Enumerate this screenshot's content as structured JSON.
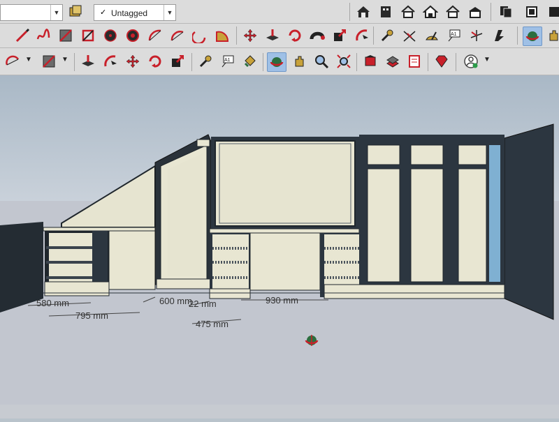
{
  "toolbar": {
    "layer": {
      "selected": "Untagged",
      "check": "✓"
    },
    "rows": [
      {
        "row": "standard",
        "tools": [
          "style-icon",
          "house-icon",
          "component-icon",
          "house-outline-icon",
          "home-icon",
          "warehouse-icon",
          "paste-icon",
          "scenes-icon",
          "paint-icon"
        ]
      },
      {
        "row": "drawing",
        "tools": [
          "line-icon",
          "freehand-icon",
          "rectangle-icon",
          "rotated-rectangle-icon",
          "circle-icon",
          "polygon-icon",
          "arc-icon",
          "two-point-arc-icon",
          "three-point-arc-icon",
          "pie-icon",
          "move-icon",
          "push-pull-icon",
          "rotate-icon",
          "follow-me-icon",
          "scale-icon",
          "offset-icon",
          "tape-measure-icon",
          "dimension-icon",
          "protractor-icon",
          "text-icon",
          "axes-icon",
          "3d-text-icon",
          "orbit-icon"
        ]
      },
      {
        "row": "getting-started",
        "tools": [
          "arc-icon",
          "rectangle-icon",
          "push-pull-icon",
          "offset-icon",
          "move-icon",
          "rotate-icon",
          "scale-icon",
          "tape-measure-icon",
          "text-icon",
          "paint-icon",
          "orbit-icon",
          "pan-icon",
          "zoom-icon",
          "zoom-extents-icon",
          "warehouse-icon",
          "extension-warehouse-icon",
          "layout-icon",
          "extension-manager-icon",
          "ruby-icon",
          "profile-icon"
        ]
      }
    ],
    "text_glyph": "A1"
  },
  "model": {
    "dimensions": [
      {
        "label": "580 mm"
      },
      {
        "label": "795 mm"
      },
      {
        "label": "600 mm"
      },
      {
        "label": "22 mm"
      },
      {
        "label": "475 mm"
      },
      {
        "label": "930 mm"
      }
    ]
  },
  "colors": {
    "toolbar_bg": "#dcdcdc",
    "sky": "#c6cfd8",
    "ground": "#c2c6cf",
    "panel": "#e8e6d2",
    "carcass_dark": "#2c3640",
    "accent_red": "#c8202a",
    "accent_blue": "#9fc0e6"
  }
}
